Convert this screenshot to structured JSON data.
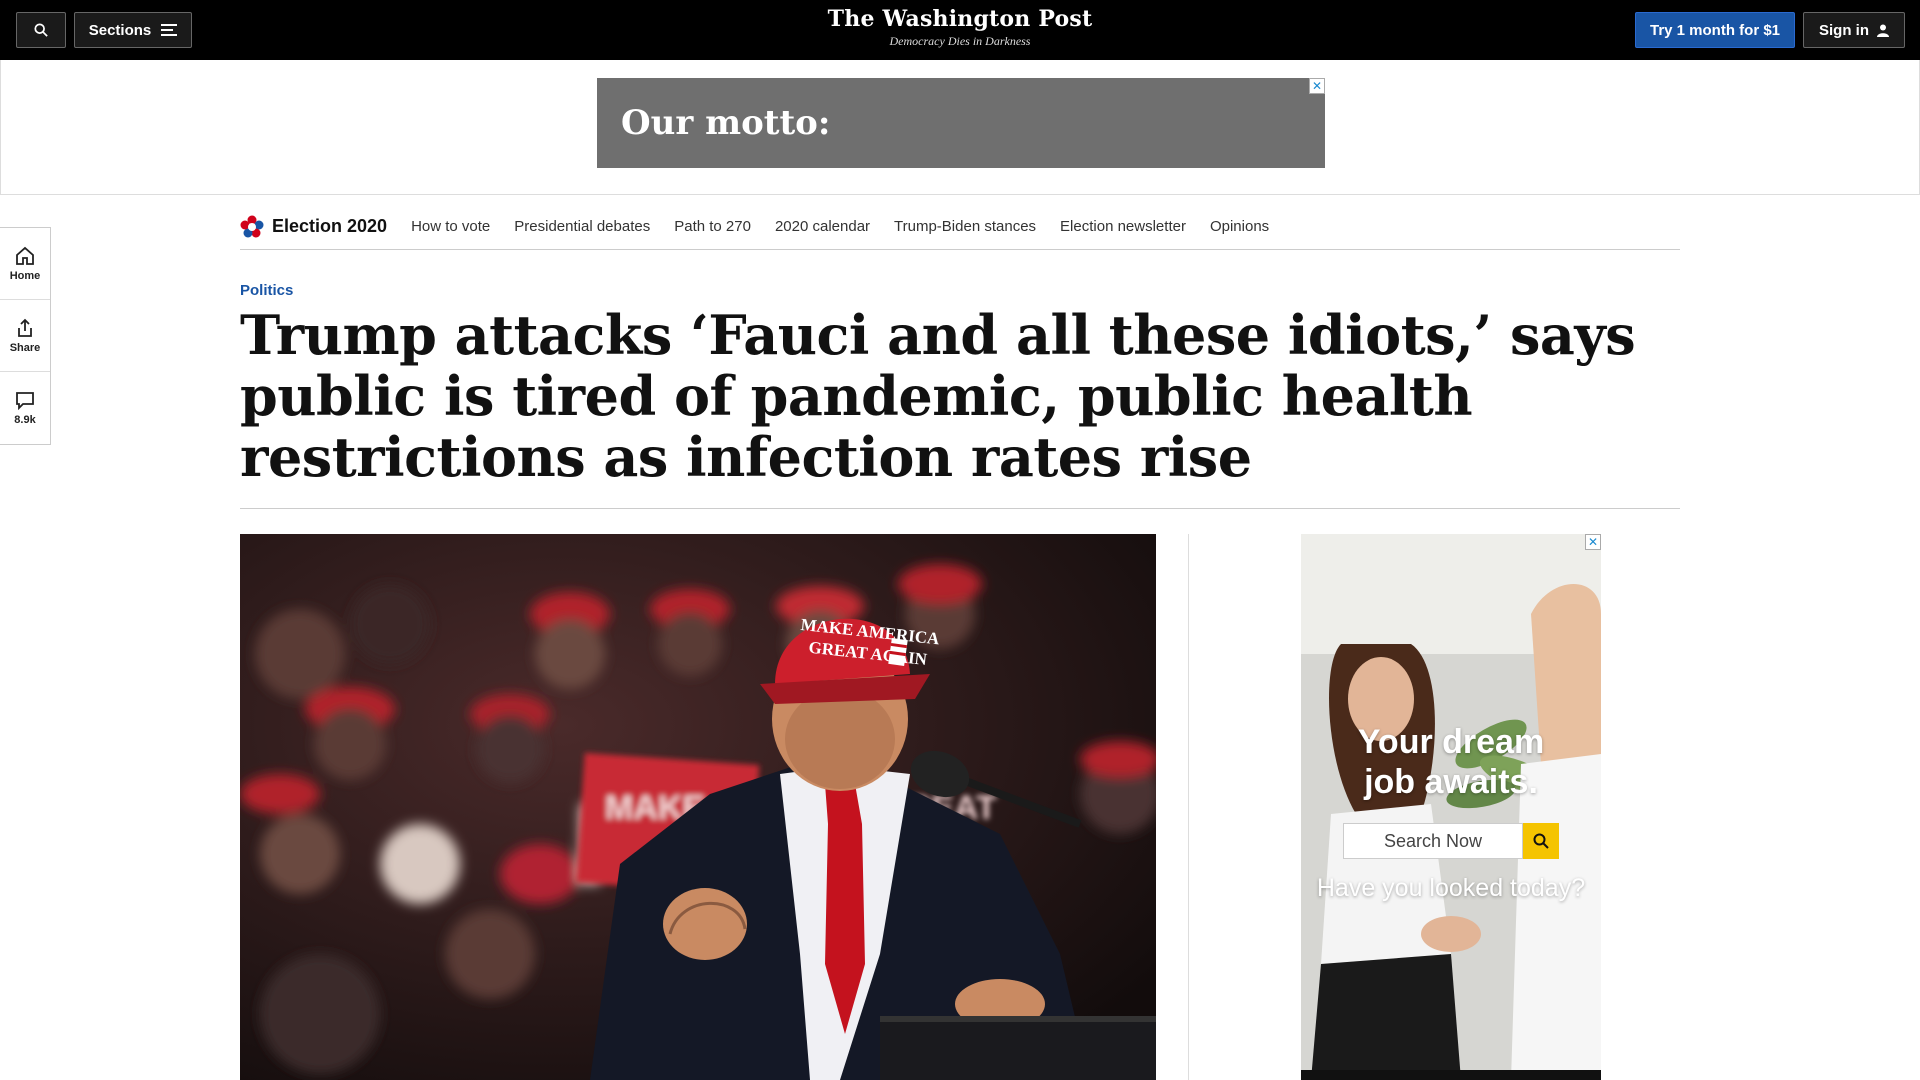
{
  "masthead": {
    "sections_label": "Sections",
    "logo": "The Washington Post",
    "tagline": "Democracy Dies in Darkness",
    "subscribe_label": "Try 1 month for $1",
    "signin_label": "Sign in"
  },
  "top_ad": {
    "text": "Our motto:",
    "close_glyph": "✕"
  },
  "left_rail": {
    "home_label": "Home",
    "share_label": "Share",
    "comments_label": "8.9k"
  },
  "election_nav": {
    "brand": "Election 2020",
    "links": [
      "How to vote",
      "Presidential debates",
      "Path to 270",
      "2020 calendar",
      "Trump-Biden stances",
      "Election newsletter",
      "Opinions"
    ]
  },
  "article": {
    "kicker": "Politics",
    "headline": "Trump attacks ‘Fauci and all these idiots,’ says public is tired of pandemic, public health restrictions as infection rates rise",
    "photo_text": {
      "hat_line1": "MAKE AMERICA",
      "hat_line2": "GREAT AGAIN",
      "sign_text": "MAKE AMERICA GREAT"
    }
  },
  "side_ad": {
    "close_glyph": "✕",
    "headline_line1": "Your dream",
    "headline_line2": "job awaits.",
    "search_placeholder": "Search Now",
    "subline": "Have you looked today?"
  },
  "colors": {
    "masthead_bg": "#000000",
    "subscribe_blue": "#1955a5",
    "kicker_blue": "#1955a5",
    "ad_gray": "#6f6f6f",
    "search_yellow": "#f5c400"
  }
}
